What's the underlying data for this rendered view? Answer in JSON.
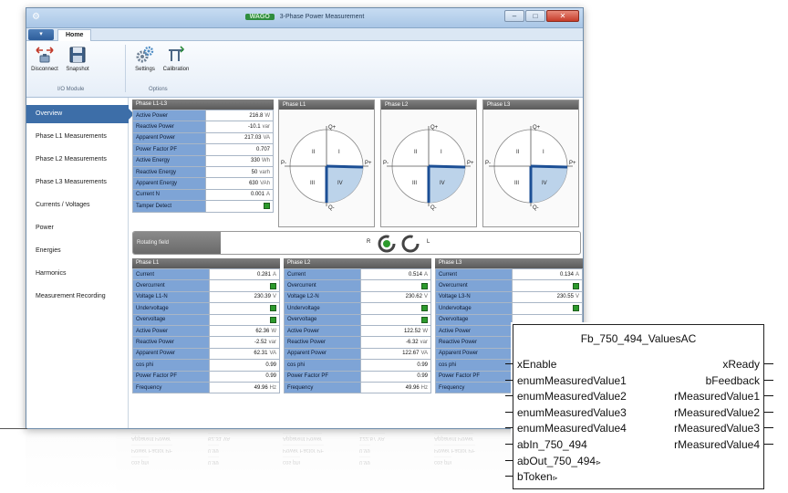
{
  "window": {
    "app_icon": "⚙",
    "logo_text": "WAGO",
    "title": "3-Phase Power Measurement",
    "controls": [
      "–",
      "□",
      "✕"
    ]
  },
  "ribbon": {
    "app_menu": "▾",
    "tab_home": "Home",
    "buttons": [
      {
        "label": "Disconnect",
        "icon": "disconnect-icon"
      },
      {
        "label": "Snapshot",
        "icon": "save-icon"
      },
      {
        "label": "Settings",
        "icon": "gears-icon"
      },
      {
        "label": "Calibration",
        "icon": "calibration-icon"
      }
    ],
    "groups": [
      "I/O Module",
      "Options"
    ]
  },
  "sidebar": {
    "items": [
      "Overview",
      "Phase L1 Measurements",
      "Phase L2 Measurements",
      "Phase L3 Measurements",
      "Currents / Voltages",
      "Power",
      "Energies",
      "Harmonics",
      "Measurement Recording"
    ],
    "active_index": 0
  },
  "overview": {
    "header": "Phase L1-L3",
    "rows": [
      {
        "label": "Active Power",
        "value": "216.8",
        "unit": "W"
      },
      {
        "label": "Reactive Power",
        "value": "-10.1",
        "unit": "var"
      },
      {
        "label": "Apparent Power",
        "value": "217.03",
        "unit": "VA"
      },
      {
        "label": "Power Factor PF",
        "value": "0.707",
        "unit": ""
      },
      {
        "label": "Active Energy",
        "value": "330",
        "unit": "Wh"
      },
      {
        "label": "Reactive Energy",
        "value": "50",
        "unit": "varh"
      },
      {
        "label": "Apparent Energy",
        "value": "630",
        "unit": "VAh"
      },
      {
        "label": "Current N",
        "value": "0.001",
        "unit": "A"
      },
      {
        "label": "Tamper Detect",
        "value": "",
        "unit": "",
        "led": true
      }
    ]
  },
  "quadrants": [
    {
      "header": "Phase L1",
      "labels": {
        "q_plus": "Q+",
        "q_minus": "Q-",
        "p_plus": "P+",
        "p_minus": "P-",
        "q1": "I",
        "q2": "II",
        "q3": "III",
        "q4": "IV"
      }
    },
    {
      "header": "Phase L2",
      "labels": {
        "q_plus": "Q+",
        "q_minus": "Q-",
        "p_plus": "P+",
        "p_minus": "P-",
        "q1": "I",
        "q2": "II",
        "q3": "III",
        "q4": "IV"
      }
    },
    {
      "header": "Phase L3",
      "labels": {
        "q_plus": "Q+",
        "q_minus": "Q-",
        "p_plus": "P+",
        "p_minus": "P-",
        "q1": "I",
        "q2": "II",
        "q3": "III",
        "q4": "IV"
      }
    }
  ],
  "rotating_field": {
    "label": "Rotating field",
    "left": "R",
    "right": "L"
  },
  "phases": [
    {
      "header": "Phase L1",
      "rows": [
        {
          "label": "Current",
          "value": "0.281",
          "unit": "A"
        },
        {
          "label": "Overcurrent",
          "value": "",
          "unit": "",
          "led": true
        },
        {
          "label": "Voltage L1-N",
          "value": "230.39",
          "unit": "V"
        },
        {
          "label": "Undervoltage",
          "value": "",
          "unit": "",
          "led": true
        },
        {
          "label": "Overvoltage",
          "value": "",
          "unit": "",
          "led": true
        },
        {
          "label": "Active Power",
          "value": "62.36",
          "unit": "W"
        },
        {
          "label": "Reactive Power",
          "value": "-2.52",
          "unit": "var"
        },
        {
          "label": "Apparent Power",
          "value": "62.31",
          "unit": "VA"
        },
        {
          "label": "cos phi",
          "value": "0.99",
          "unit": ""
        },
        {
          "label": "Power Factor PF",
          "value": "0.99",
          "unit": ""
        },
        {
          "label": "Frequency",
          "value": "49.96",
          "unit": "Hz"
        }
      ]
    },
    {
      "header": "Phase L2",
      "rows": [
        {
          "label": "Current",
          "value": "0.514",
          "unit": "A"
        },
        {
          "label": "Overcurrent",
          "value": "",
          "unit": "",
          "led": true
        },
        {
          "label": "Voltage L2-N",
          "value": "230.62",
          "unit": "V"
        },
        {
          "label": "Undervoltage",
          "value": "",
          "unit": "",
          "led": true
        },
        {
          "label": "Overvoltage",
          "value": "",
          "unit": "",
          "led": true
        },
        {
          "label": "Active Power",
          "value": "122.52",
          "unit": "W"
        },
        {
          "label": "Reactive Power",
          "value": "-6.32",
          "unit": "var"
        },
        {
          "label": "Apparent Power",
          "value": "122.67",
          "unit": "VA"
        },
        {
          "label": "cos phi",
          "value": "0.99",
          "unit": ""
        },
        {
          "label": "Power Factor PF",
          "value": "0.99",
          "unit": ""
        },
        {
          "label": "Frequency",
          "value": "49.96",
          "unit": "Hz"
        }
      ]
    },
    {
      "header": "Phase L3",
      "rows": [
        {
          "label": "Current",
          "value": "0.134",
          "unit": "A"
        },
        {
          "label": "Overcurrent",
          "value": "",
          "unit": "",
          "led": true
        },
        {
          "label": "Voltage L3-N",
          "value": "230.55",
          "unit": "V"
        },
        {
          "label": "Undervoltage",
          "value": "",
          "unit": "",
          "led": true
        },
        {
          "label": "Overvoltage",
          "value": "",
          "unit": "",
          "led": false
        },
        {
          "label": "Active Power",
          "value": "",
          "unit": ""
        },
        {
          "label": "Reactive Power",
          "value": "",
          "unit": ""
        },
        {
          "label": "Apparent Power",
          "value": "",
          "unit": ""
        },
        {
          "label": "cos phi",
          "value": "",
          "unit": ""
        },
        {
          "label": "Power Factor PF",
          "value": "",
          "unit": ""
        },
        {
          "label": "Frequency",
          "value": "",
          "unit": ""
        }
      ]
    }
  ],
  "reflection": [
    [
      "Apparent Power",
      "62.31 VA",
      "Apparent Power",
      "122.67 VA",
      "Apparent Power"
    ],
    [
      "Power Factor PF",
      "0.99",
      "Power Factor PF",
      "0.99",
      "Power Factor PF"
    ],
    [
      "cos phi",
      "0.99",
      "cos phi",
      "0.99",
      "cos phi"
    ]
  ],
  "function_block": {
    "title": "Fb_750_494_ValuesAC",
    "inputs": [
      "xEnable",
      "enumMeasuredValue1",
      "enumMeasuredValue2",
      "enumMeasuredValue3",
      "enumMeasuredValue4",
      "abIn_750_494",
      "abOut_750_494",
      "bToken"
    ],
    "outputs": [
      "xReady",
      "bFeedback",
      "rMeasuredValue1",
      "rMeasuredValue2",
      "rMeasuredValue3",
      "rMeasuredValue4"
    ],
    "inout_marker": "⊳"
  },
  "colors": {
    "accent": "#3d6ea8",
    "label_cell": "#7ea4d6",
    "led_on": "#2c9a2c",
    "quadrant_fill": "#bcd3ea",
    "vector": "#1c4f95"
  }
}
